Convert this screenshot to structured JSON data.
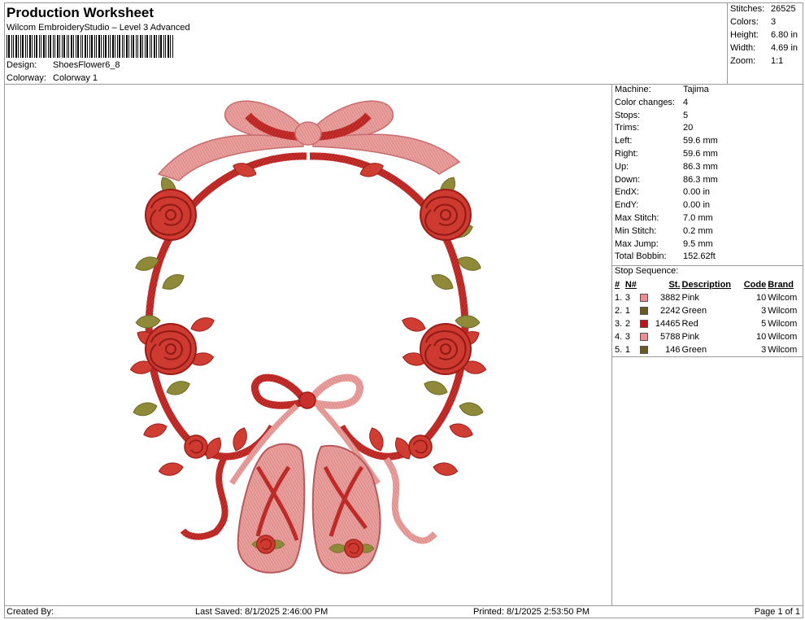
{
  "header": {
    "title": "Production Worksheet",
    "subtitle": "Wilcom EmbroideryStudio – Level 3 Advanced",
    "design_label": "Design:",
    "design_value": "ShoesFlower6_8",
    "colorway_label": "Colorway:",
    "colorway_value": "Colorway 1"
  },
  "summary": [
    {
      "label": "Stitches:",
      "value": "26525"
    },
    {
      "label": "Colors:",
      "value": "3"
    },
    {
      "label": "Height:",
      "value": "6.80 in"
    },
    {
      "label": "Width:",
      "value": "4.69 in"
    },
    {
      "label": "Zoom:",
      "value": "1:1"
    }
  ],
  "machine_stats": [
    {
      "label": "Machine:",
      "value": "Tajima"
    },
    {
      "label": "Color changes:",
      "value": "4"
    },
    {
      "label": "Stops:",
      "value": "5"
    },
    {
      "label": "Trims:",
      "value": "20"
    },
    {
      "label": "Left:",
      "value": "59.6 mm"
    },
    {
      "label": "Right:",
      "value": "59.6 mm"
    },
    {
      "label": "Up:",
      "value": "86.3 mm"
    },
    {
      "label": "Down:",
      "value": "86.3 mm"
    },
    {
      "label": "EndX:",
      "value": "0.00 in"
    },
    {
      "label": "EndY:",
      "value": "0.00 in"
    },
    {
      "label": "Max Stitch:",
      "value": "7.0 mm"
    },
    {
      "label": "Min Stitch:",
      "value": "0.2 mm"
    },
    {
      "label": "Max Jump:",
      "value": "9.5 mm"
    },
    {
      "label": "Total Bobbin:",
      "value": "152.62ft"
    }
  ],
  "stop_sequence": {
    "title": "Stop Sequence:",
    "columns": {
      "num": "#",
      "n": "N#",
      "st": "St.",
      "desc": "Description",
      "code": "Code",
      "brand": "Brand"
    },
    "rows": [
      {
        "num": "1.",
        "n": "3",
        "color": "#f08a93",
        "st": "3882",
        "desc": "Pink",
        "code": "10",
        "brand": "Wilcom"
      },
      {
        "num": "2.",
        "n": "1",
        "color": "#6b5a1f",
        "st": "2242",
        "desc": "Green",
        "code": "3",
        "brand": "Wilcom"
      },
      {
        "num": "3.",
        "n": "2",
        "color": "#c0121a",
        "st": "14465",
        "desc": "Red",
        "code": "5",
        "brand": "Wilcom"
      },
      {
        "num": "4.",
        "n": "3",
        "color": "#f08a93",
        "st": "5788",
        "desc": "Pink",
        "code": "10",
        "brand": "Wilcom"
      },
      {
        "num": "5.",
        "n": "1",
        "color": "#6b5a1f",
        "st": "146",
        "desc": "Green",
        "code": "3",
        "brand": "Wilcom"
      }
    ]
  },
  "footer": {
    "created_by": "Created By:",
    "last_saved": "Last Saved: 8/1/2025 2:46:00 PM",
    "printed": "Printed: 8/1/2025 2:53:50 PM",
    "page": "Page 1 of 1"
  },
  "colors": {
    "red": "#c8302c",
    "pink": "#e9989a",
    "green": "#8f8a3a",
    "border": "#9a9a9a"
  }
}
